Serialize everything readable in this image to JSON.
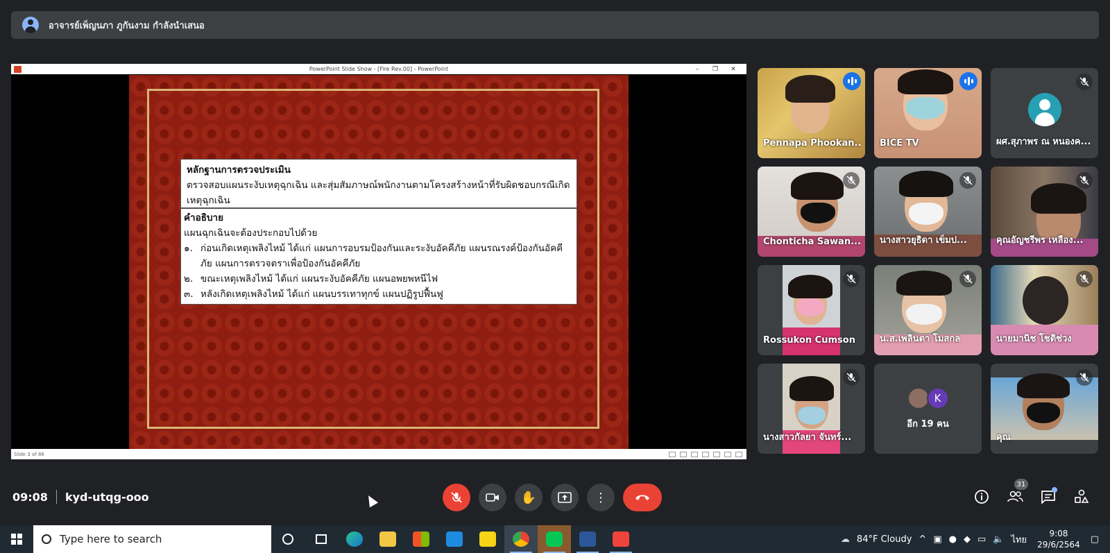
{
  "banner": {
    "presenter_text": "อาจารย์เพ็ญนภา ภูกันงาม กำลังนำเสนอ"
  },
  "presentation": {
    "window_title": "PowerPoint Slide Show - [Fire Rev.00] - PowerPoint",
    "status_left": "Slide 3 of 86",
    "slide": {
      "heading1": "หลักฐานการตรวจประเมิน",
      "text1": "ตรวจสอบแผนระงับเหตุฉุกเฉิน และสุ่มสัมภาษณ์พนักงานตามโครงสร้างหน้าที่รับผิดชอบกรณีเกิดเหตุฉุกเฉิน",
      "heading2": "คำอธิบาย",
      "text2": "แผนฉุกเฉินจะต้องประกอบไปด้วย",
      "items": [
        {
          "num": "๑.",
          "text": "ก่อนเกิดเหตุเพลิงไหม้ ได้แก่ แผนการอบรมป้องกันและระงับอัคคีภัย แผนรณรงค์ป้องกันอัคคีภัย แผนการตรวจตราเพื่อป้องกันอัคคีภัย"
        },
        {
          "num": "๒.",
          "text": "ขณะเหตุเพลิงไหม้ ได้แก่ แผนระงับอัคคีภัย แผนอพยพหนีไฟ"
        },
        {
          "num": "๓.",
          "text": "หลังเกิดเหตุเพลิงไหม้ ได้แก่ แผนบรรเทาทุกข์ แผนปฏิรูปฟื้นฟู"
        }
      ]
    }
  },
  "participants": [
    {
      "name": "Pennapa Phookan...",
      "state": "speaking",
      "active": true
    },
    {
      "name": "BICE TV",
      "state": "speaking"
    },
    {
      "name": "ผศ.สุภาพร ณ หนองค...",
      "state": "muted",
      "avatar": true
    },
    {
      "name": "Chonticha Sawan...",
      "state": "muted"
    },
    {
      "name": "นางสาวยุธิดา เข็มป...",
      "state": "muted"
    },
    {
      "name": "คุณอัญชรีพร เหลือง...",
      "state": "muted"
    },
    {
      "name": "Rossukon Cumson",
      "state": "muted"
    },
    {
      "name": "น.ส.เพลินตา โมสกล",
      "state": "muted"
    },
    {
      "name": "นายมานิช โชติช่วง",
      "state": "muted"
    },
    {
      "name": "นางสาวกัลยา จันทร์...",
      "state": "muted"
    },
    {
      "name": "อีก 19 คน",
      "state": "more",
      "initial": "K"
    },
    {
      "name": "คุณ",
      "state": "muted"
    }
  ],
  "meeting": {
    "time": "09:08",
    "code": "kyd-utqg-ooo",
    "people_count": "31"
  },
  "taskbar": {
    "search_placeholder": "Type here to search",
    "weather": "84°F  Cloudy",
    "lang": "ไทย",
    "time": "9:08",
    "date": "29/6/2564"
  }
}
